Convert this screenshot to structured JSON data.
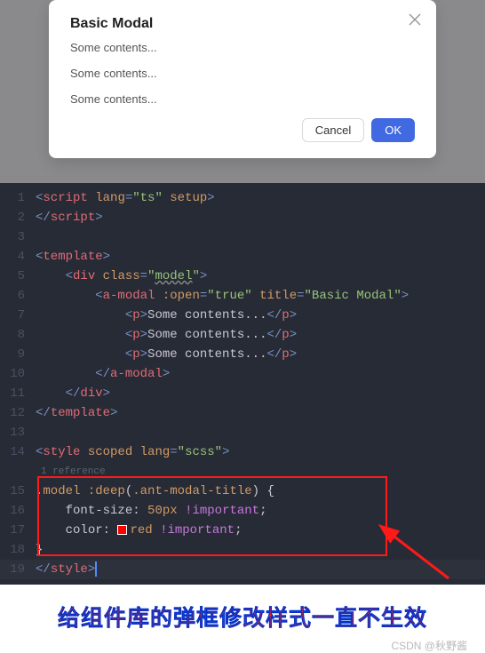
{
  "modal": {
    "title": "Basic Modal",
    "lines": [
      "Some contents...",
      "Some contents...",
      "Some contents..."
    ],
    "cancel": "Cancel",
    "ok": "OK"
  },
  "code": {
    "ref_text": "1 reference",
    "lines": [
      {
        "n": "1",
        "html": "<span class='tag-bracket'>&lt;</span><span class='tag-name'>script</span> <span class='attr-name'>lang</span><span class='tag-bracket'>=</span><span class='attr-val'>\"ts\"</span> <span class='attr-name'>setup</span><span class='tag-bracket'>&gt;</span>"
      },
      {
        "n": "2",
        "html": "<span class='tag-bracket'>&lt;/</span><span class='tag-name'>script</span><span class='tag-bracket'>&gt;</span>"
      },
      {
        "n": "3",
        "html": ""
      },
      {
        "n": "4",
        "html": "<span class='tag-bracket'>&lt;</span><span class='tag-name'>template</span><span class='tag-bracket'>&gt;</span>"
      },
      {
        "n": "5",
        "html": "    <span class='tag-bracket'>&lt;</span><span class='tag-name'>div</span> <span class='attr-name'>class</span><span class='tag-bracket'>=</span><span class='attr-val'>\"<span class='squiggle'>model</span>\"</span><span class='tag-bracket'>&gt;</span>"
      },
      {
        "n": "6",
        "html": "        <span class='tag-bracket'>&lt;</span><span class='tag-name'>a-modal</span> <span class='attr-name'>:open</span><span class='tag-bracket'>=</span><span class='attr-val'>\"true\"</span> <span class='attr-name'>title</span><span class='tag-bracket'>=</span><span class='attr-val'>\"Basic Modal\"</span><span class='tag-bracket'>&gt;</span>"
      },
      {
        "n": "7",
        "html": "            <span class='tag-bracket'>&lt;</span><span class='tag-name'>p</span><span class='tag-bracket'>&gt;</span><span class='text-content'>Some contents...</span><span class='tag-bracket'>&lt;/</span><span class='tag-name'>p</span><span class='tag-bracket'>&gt;</span>"
      },
      {
        "n": "8",
        "html": "            <span class='tag-bracket'>&lt;</span><span class='tag-name'>p</span><span class='tag-bracket'>&gt;</span><span class='text-content'>Some contents...</span><span class='tag-bracket'>&lt;/</span><span class='tag-name'>p</span><span class='tag-bracket'>&gt;</span>"
      },
      {
        "n": "9",
        "html": "            <span class='tag-bracket'>&lt;</span><span class='tag-name'>p</span><span class='tag-bracket'>&gt;</span><span class='text-content'>Some contents...</span><span class='tag-bracket'>&lt;/</span><span class='tag-name'>p</span><span class='tag-bracket'>&gt;</span>"
      },
      {
        "n": "10",
        "html": "        <span class='tag-bracket'>&lt;/</span><span class='tag-name'>a-modal</span><span class='tag-bracket'>&gt;</span>"
      },
      {
        "n": "11",
        "html": "    <span class='tag-bracket'>&lt;/</span><span class='tag-name'>div</span><span class='tag-bracket'>&gt;</span>"
      },
      {
        "n": "12",
        "html": "<span class='tag-bracket'>&lt;/</span><span class='tag-name'>template</span><span class='tag-bracket'>&gt;</span>"
      },
      {
        "n": "13",
        "html": ""
      },
      {
        "n": "14",
        "html": "<span class='tag-bracket'>&lt;</span><span class='tag-name'>style</span> <span class='attr-name'>scoped</span> <span class='attr-name'>lang</span><span class='tag-bracket'>=</span><span class='attr-val'>\"scss\"</span><span class='tag-bracket'>&gt;</span>"
      },
      {
        "n": "15",
        "html": "<span class='css-class'>.model </span><span class='selector'>:deep</span><span class='brace'>(</span><span class='css-class'>.ant-modal-title</span><span class='brace'>) {</span>"
      },
      {
        "n": "16",
        "html": "    <span class='css-prop'>font-size</span><span class='brace'>:</span> <span class='css-val'>50px</span> <span class='important'>!important</span><span class='brace'>;</span>"
      },
      {
        "n": "17",
        "html": "    <span class='css-prop'>color</span><span class='brace'>:</span> <span class='color-swatch'></span><span class='css-val'>red</span> <span class='important'>!important</span><span class='brace'>;</span>"
      },
      {
        "n": "18",
        "html": "<span class='brace'>}</span>"
      },
      {
        "n": "19",
        "html": "<span class='tag-bracket'>&lt;/</span><span class='tag-name'>style</span><span class='tag-bracket'>&gt;</span><span class='cursor-bar'></span>",
        "cursor": true
      }
    ]
  },
  "caption": "给组件库的弹框修改样式一直不生效",
  "watermark": "CSDN @秋野酱"
}
